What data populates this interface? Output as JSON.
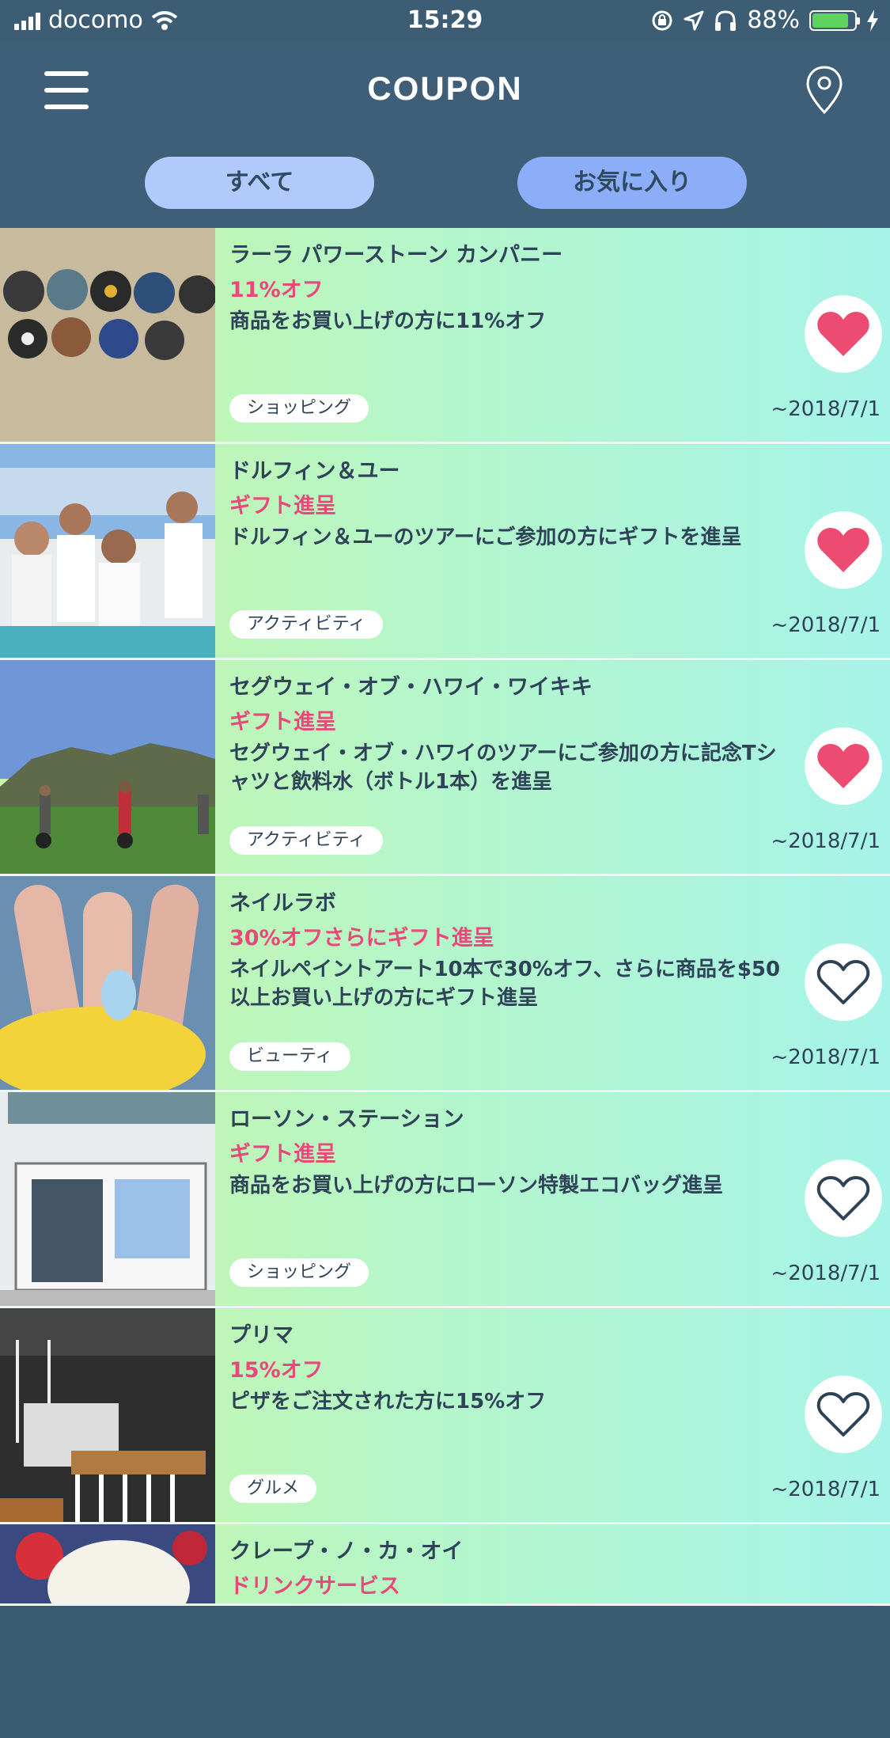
{
  "status_bar": {
    "carrier": "docomo",
    "time": "15:29",
    "battery": "88%"
  },
  "header": {
    "title": "COUPON",
    "tabs": [
      {
        "label": "すべて"
      },
      {
        "label": "お気に入り"
      }
    ]
  },
  "colors": {
    "header_bg": "#3e5f77",
    "offer_text": "#e8497a",
    "heart_filled": "#ec4b72",
    "tab_all": "#b1c9fb",
    "tab_fav": "#8cadf8"
  },
  "coupons": [
    {
      "name": "ラーラ パワーストーン カンパニー",
      "offer": "11%オフ",
      "description": "商品をお買い上げの方に11%オフ",
      "category": "ショッピング",
      "expiry": "~2018/7/1",
      "favorite": true,
      "icon": "heart-filled-icon"
    },
    {
      "name": "ドルフィン＆ユー",
      "offer": "ギフト進呈",
      "description": "ドルフィン＆ユーのツアーにご参加の方にギフトを進呈",
      "category": "アクティビティ",
      "expiry": "~2018/7/1",
      "favorite": true,
      "icon": "heart-filled-icon"
    },
    {
      "name": "セグウェイ・オブ・ハワイ・ワイキキ",
      "offer": "ギフト進呈",
      "description": "セグウェイ・オブ・ハワイのツアーにご参加の方に記念Tシャツと飲料水（ボトル1本）を進呈",
      "category": "アクティビティ",
      "expiry": "~2018/7/1",
      "favorite": true,
      "icon": "heart-filled-icon"
    },
    {
      "name": "ネイルラボ",
      "offer": "30%オフさらにギフト進呈",
      "description": "ネイルペイントアート10本で30%オフ、さらに商品を$50以上お買い上げの方にギフト進呈",
      "category": "ビューティ",
      "expiry": "~2018/7/1",
      "favorite": false,
      "icon": "heart-outline-icon"
    },
    {
      "name": "ローソン・ステーション",
      "offer": "ギフト進呈",
      "description": "商品をお買い上げの方にローソン特製エコバッグ進呈",
      "category": "ショッピング",
      "expiry": "~2018/7/1",
      "favorite": false,
      "icon": "heart-outline-icon"
    },
    {
      "name": "プリマ",
      "offer": "15%オフ",
      "description": "ピザをご注文された方に15%オフ",
      "category": "グルメ",
      "expiry": "~2018/7/1",
      "favorite": false,
      "icon": "heart-outline-icon"
    },
    {
      "name": "クレープ・ノ・カ・オイ",
      "offer": "ドリンクサービス"
    }
  ]
}
